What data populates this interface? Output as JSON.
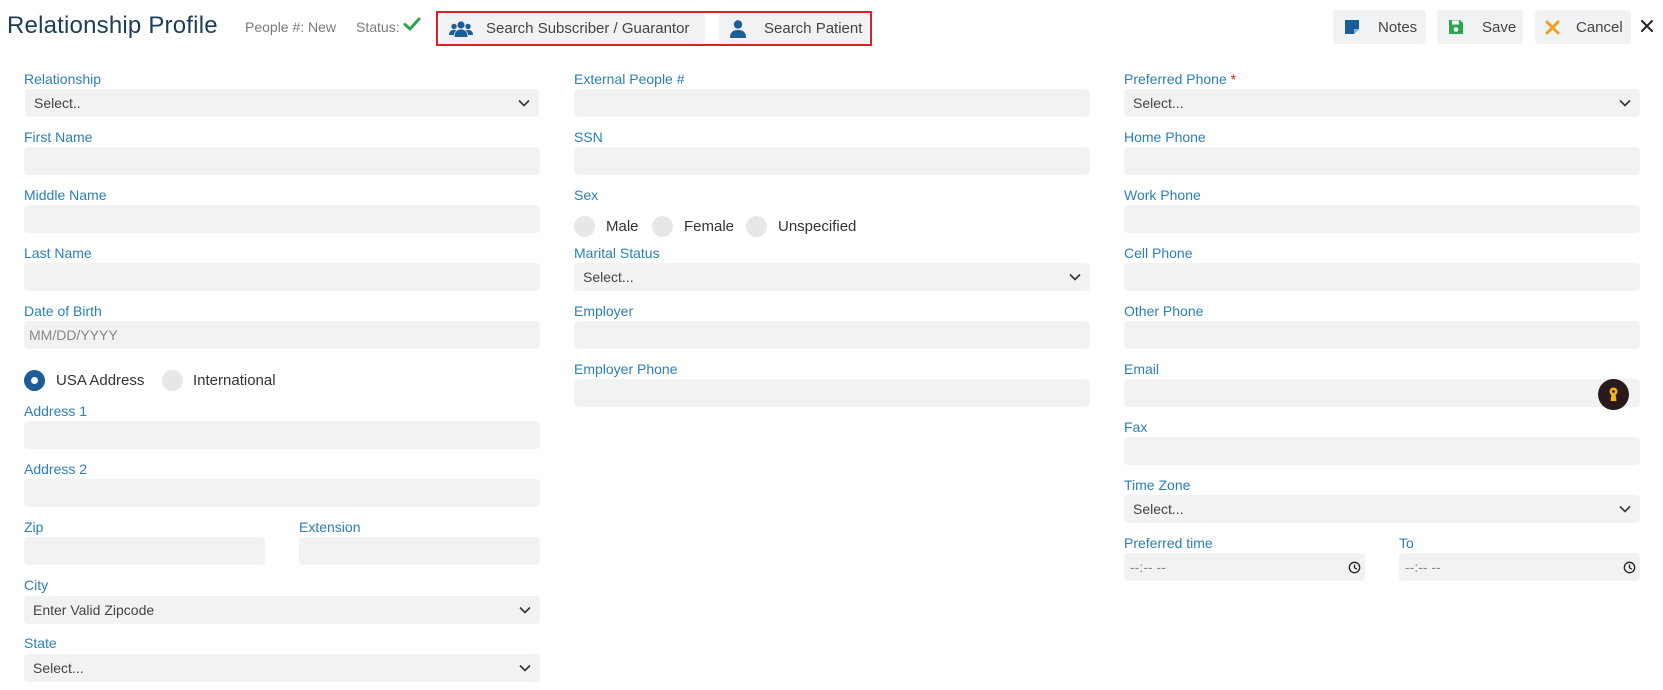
{
  "header": {
    "title": "Relationship Profile",
    "people_label": "People #:",
    "people_value": "New",
    "status_label": "Status:",
    "status_color": "#2ea44f",
    "search_subscriber_label": "Search Subscriber / Guarantor",
    "search_patient_label": "Search Patient",
    "notes_label": "Notes",
    "save_label": "Save",
    "cancel_label": "Cancel",
    "icons": {
      "subscriber": "users-icon",
      "patient": "user-icon",
      "notes": "sticky-note-icon",
      "save": "floppy-disk-icon",
      "cancel": "x-icon",
      "close": "close-icon",
      "status": "check-icon"
    },
    "colors": {
      "notes_icon": "#1b5e97",
      "save_icon": "#2ea44f",
      "cancel_icon": "#f0a020",
      "search_highlight": "#e02020"
    }
  },
  "left": {
    "relationship": {
      "label": "Relationship",
      "value": "Select.."
    },
    "first_name": {
      "label": "First Name",
      "value": ""
    },
    "middle_name": {
      "label": "Middle Name",
      "value": ""
    },
    "last_name": {
      "label": "Last Name",
      "value": ""
    },
    "dob": {
      "label": "Date of Birth",
      "placeholder": "MM/DD/YYYY"
    },
    "address_type": {
      "usa_label": "USA Address",
      "intl_label": "International",
      "selected": "USA Address"
    },
    "address1": {
      "label": "Address 1",
      "value": ""
    },
    "address2": {
      "label": "Address 2",
      "value": ""
    },
    "zip": {
      "label": "Zip",
      "value": ""
    },
    "extension": {
      "label": "Extension",
      "value": ""
    },
    "city": {
      "label": "City",
      "value": "Enter Valid Zipcode"
    },
    "state": {
      "label": "State",
      "value": "Select..."
    }
  },
  "middle": {
    "external_people": {
      "label": "External People #",
      "value": ""
    },
    "ssn": {
      "label": "SSN",
      "value": ""
    },
    "sex": {
      "label": "Sex",
      "options": [
        "Male",
        "Female",
        "Unspecified"
      ]
    },
    "marital_status": {
      "label": "Marital Status",
      "value": "Select..."
    },
    "employer": {
      "label": "Employer",
      "value": ""
    },
    "employer_phone": {
      "label": "Employer Phone",
      "value": ""
    }
  },
  "right": {
    "preferred_phone": {
      "label": "Preferred Phone",
      "required_mark": "*",
      "value": "Select..."
    },
    "home_phone": {
      "label": "Home Phone",
      "value": ""
    },
    "work_phone": {
      "label": "Work Phone",
      "value": ""
    },
    "cell_phone": {
      "label": "Cell Phone",
      "value": ""
    },
    "other_phone": {
      "label": "Other Phone",
      "value": ""
    },
    "email": {
      "label": "Email",
      "value": ""
    },
    "fax": {
      "label": "Fax",
      "value": ""
    },
    "time_zone": {
      "label": "Time Zone",
      "value": "Select..."
    },
    "preferred_time": {
      "label": "Preferred time",
      "placeholder": "--:-- --"
    },
    "to_time": {
      "label": "To",
      "placeholder": "--:-- --"
    }
  }
}
